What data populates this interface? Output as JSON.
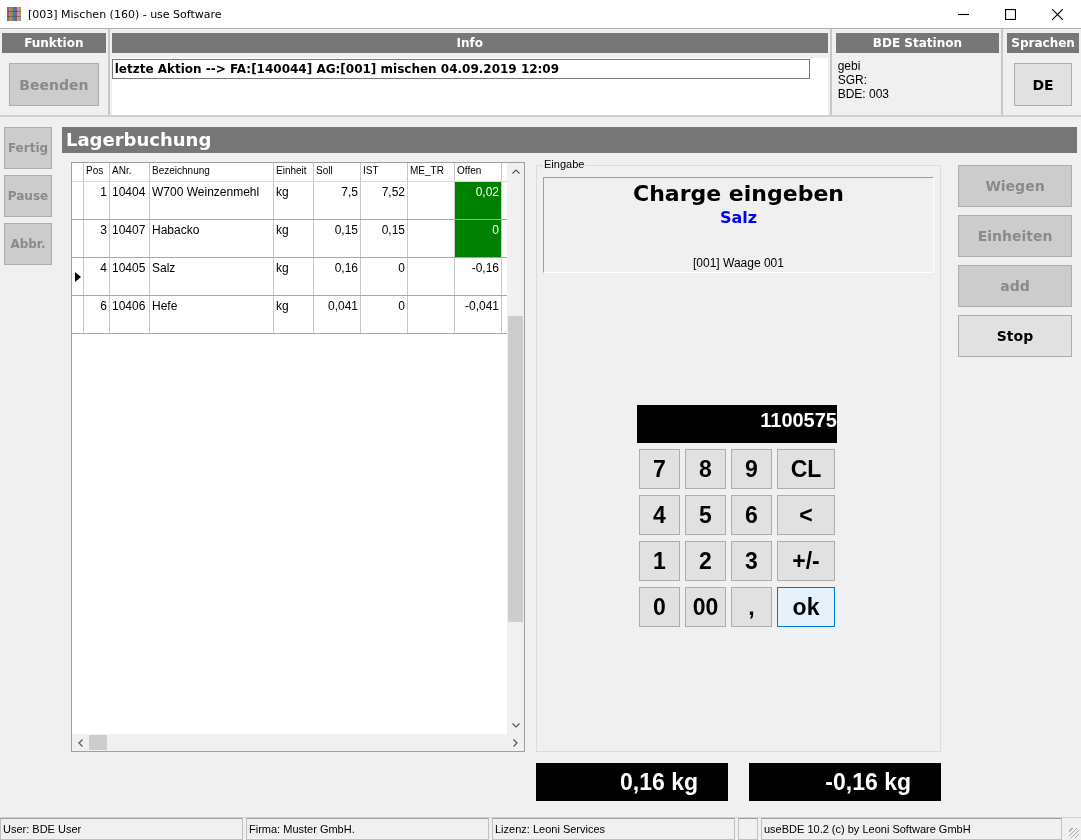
{
  "window": {
    "title": "[003] Mischen (160) - use Software"
  },
  "panels": {
    "funktion": {
      "title": "Funktion",
      "button": {
        "label": "Beenden",
        "disabled": true
      }
    },
    "info": {
      "title": "Info",
      "message": "letzte Aktion --> FA:[140044] AG:[001] mischen 04.09.2019 12:09"
    },
    "station": {
      "title": "BDE Statinon",
      "lines": [
        "gebi",
        "SGR:",
        "BDE: 003"
      ]
    },
    "sprachen": {
      "title": "Sprachen",
      "button": {
        "label": "DE",
        "disabled": false
      }
    }
  },
  "side_buttons": [
    {
      "label": "Fertig",
      "disabled": true
    },
    {
      "label": "Pause",
      "disabled": true
    },
    {
      "label": "Abbr.",
      "disabled": true
    }
  ],
  "section_title": "Lagerbuchung",
  "table": {
    "columns": [
      "Pos",
      "ANr.",
      "Bezeichnung",
      "Einheit",
      "Soll",
      "IST",
      "ME_TR",
      "Offen"
    ],
    "rows": [
      {
        "selected": false,
        "complete": true,
        "cells": [
          "1",
          "10404",
          "W700 Weinzenmehl",
          "kg",
          "7,5",
          "7,52",
          "",
          "0,02"
        ]
      },
      {
        "selected": false,
        "complete": true,
        "cells": [
          "3",
          "10407",
          "Habacko",
          "kg",
          "0,15",
          "0,15",
          "",
          "0"
        ]
      },
      {
        "selected": true,
        "complete": false,
        "cells": [
          "4",
          "10405",
          "Salz",
          "kg",
          "0,16",
          "0",
          "",
          "-0,16"
        ]
      },
      {
        "selected": false,
        "complete": false,
        "cells": [
          "6",
          "10406",
          "Hefe",
          "kg",
          "0,041",
          "0",
          "",
          "-0,041"
        ]
      }
    ]
  },
  "eingabe": {
    "legend": "Eingabe",
    "heading": "Charge eingeben",
    "item": "Salz",
    "scale": "[001] Waage 001",
    "display": "1100575",
    "keys": [
      {
        "label": "7",
        "focused": false
      },
      {
        "label": "8",
        "focused": false
      },
      {
        "label": "9",
        "focused": false
      },
      {
        "label": "CL",
        "focused": false
      },
      {
        "label": "4",
        "focused": false
      },
      {
        "label": "5",
        "focused": false
      },
      {
        "label": "6",
        "focused": false
      },
      {
        "label": "<",
        "focused": false
      },
      {
        "label": "1",
        "focused": false
      },
      {
        "label": "2",
        "focused": false
      },
      {
        "label": "3",
        "focused": false
      },
      {
        "label": "+/-",
        "focused": false
      },
      {
        "label": "0",
        "focused": false
      },
      {
        "label": "00",
        "focused": false
      },
      {
        "label": ",",
        "focused": false
      },
      {
        "label": "ok",
        "focused": true
      }
    ]
  },
  "action_buttons": [
    {
      "label": "Wiegen",
      "disabled": true
    },
    {
      "label": "Einheiten",
      "disabled": true
    },
    {
      "label": "add",
      "disabled": true
    },
    {
      "label": "Stop",
      "disabled": false
    }
  ],
  "readouts": [
    "0,16 kg",
    "-0,16 kg"
  ],
  "status_bar": {
    "segments": [
      "User: BDE User",
      "Firma: Muster GmbH.",
      "Lizenz: Leoni Services"
    ],
    "copyright": "useBDE 10.2 (c) by Leoni Software GmbH"
  }
}
